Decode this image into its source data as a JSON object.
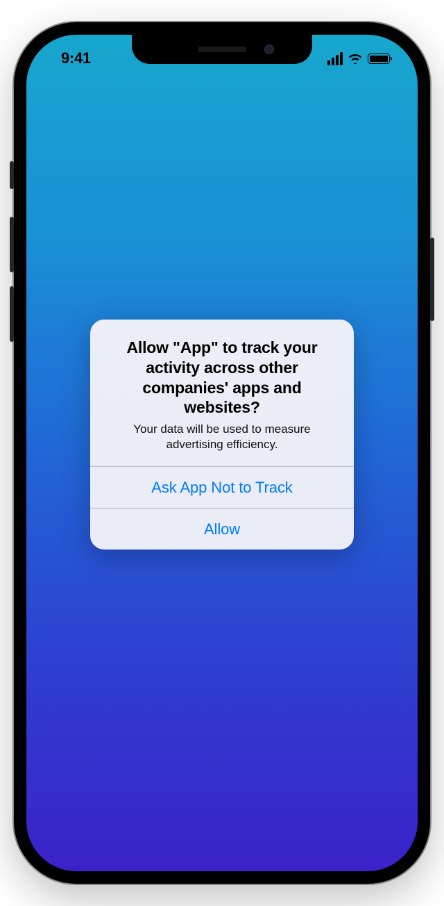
{
  "status_bar": {
    "time": "9:41"
  },
  "alert": {
    "title": "Allow \"App\" to track your activity across other companies' apps and websites?",
    "message": "Your data will be used to measure advertising efficiency.",
    "buttons": {
      "deny": "Ask App Not to Track",
      "allow": "Allow"
    }
  },
  "colors": {
    "accent": "#007aff"
  }
}
